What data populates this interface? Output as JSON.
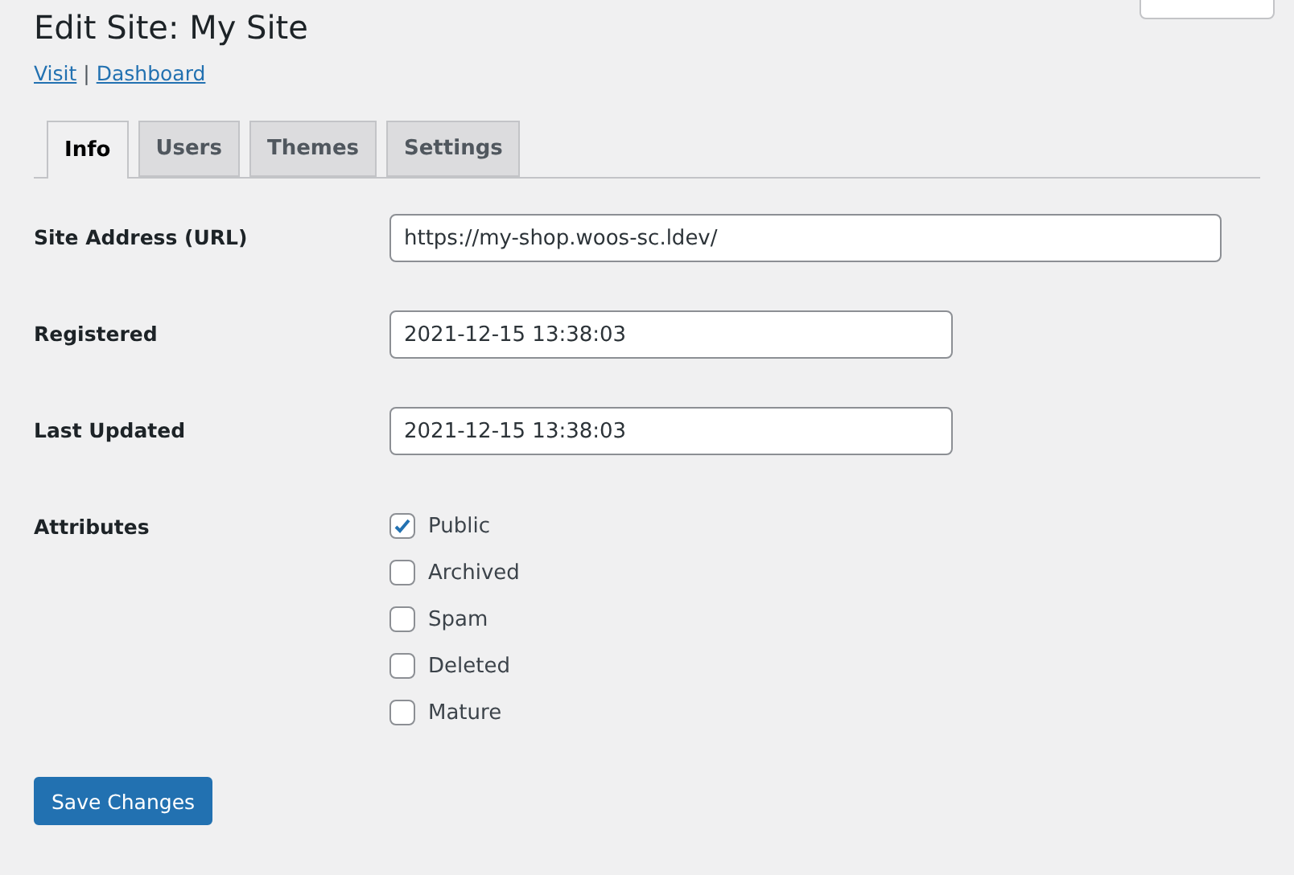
{
  "title": "Edit Site: My Site",
  "links": [
    {
      "label": "Visit"
    },
    {
      "label": "Dashboard"
    }
  ],
  "link_separator": "|",
  "tabs": [
    {
      "label": "Info",
      "selected": true
    },
    {
      "label": "Users",
      "selected": false
    },
    {
      "label": "Themes",
      "selected": false
    },
    {
      "label": "Settings",
      "selected": false
    }
  ],
  "fields": [
    {
      "label": "Site Address (URL)",
      "value": "https://my-shop.woos-sc.ldev/",
      "kind": "wide"
    },
    {
      "label": "Registered",
      "value": "2021-12-15 13:38:03",
      "kind": "narrow"
    },
    {
      "label": "Last Updated",
      "value": "2021-12-15 13:38:03",
      "kind": "narrow"
    }
  ],
  "attributes": {
    "label": "Attributes",
    "options": [
      {
        "label": "Public",
        "checked": true
      },
      {
        "label": "Archived",
        "checked": false
      },
      {
        "label": "Spam",
        "checked": false
      },
      {
        "label": "Deleted",
        "checked": false
      },
      {
        "label": "Mature",
        "checked": false
      }
    ]
  },
  "save_button": "Save Changes"
}
